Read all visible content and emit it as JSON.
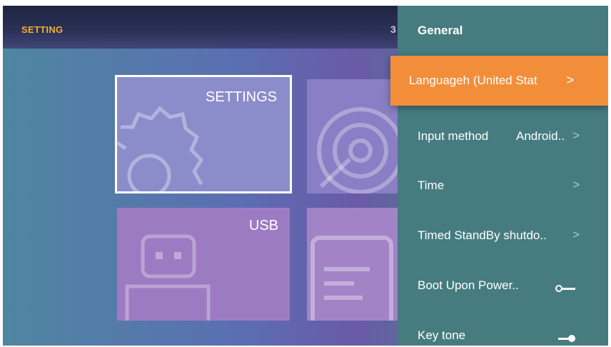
{
  "topbar": {
    "title": "SETTING",
    "clock_partial": "3"
  },
  "tiles": {
    "settings_label": "SETTINGS",
    "usb_label": "USB"
  },
  "panel": {
    "title": "General",
    "items": [
      {
        "label": "Language",
        "value": "h (United Stat",
        "chevron": ">"
      },
      {
        "label": "Input method",
        "value": "Android..",
        "chevron": ">"
      },
      {
        "label": "Time",
        "value": "",
        "chevron": ">"
      },
      {
        "label": "Timed StandBy shutdo..",
        "value": "",
        "chevron": ">"
      },
      {
        "label": "Boot Upon Power..",
        "toggle": "off"
      },
      {
        "label": "Key tone",
        "toggle": "on"
      }
    ]
  },
  "colors": {
    "accent": "#f28e3a",
    "panel": "#467c80",
    "setting_title": "#f0b12a"
  }
}
